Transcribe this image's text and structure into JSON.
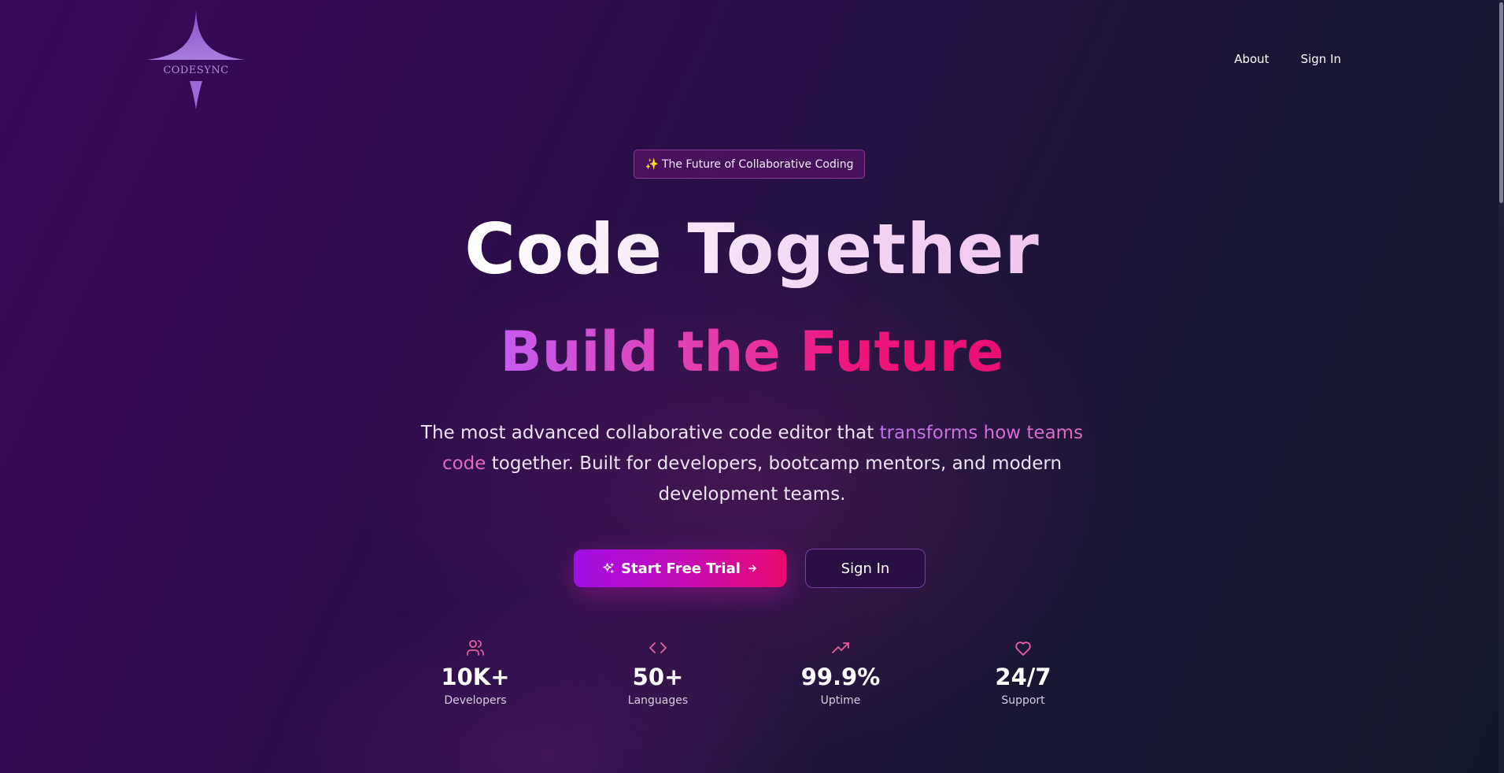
{
  "logo": {
    "text": "CODESYNC",
    "icon": "four-point-star-icon",
    "color": "#9a6ad6"
  },
  "nav": {
    "items": [
      {
        "label": "About"
      },
      {
        "label": "Sign In"
      }
    ]
  },
  "hero": {
    "badge": {
      "icon": "sparkles-icon",
      "emoji": "✨",
      "label": "The Future of Collaborative Coding"
    },
    "title": "Code Together",
    "subtitle": "Build the Future",
    "description_before": "The most advanced collaborative code editor that ",
    "description_highlight": "transforms how teams code",
    "description_after": " together. Built for developers, bootcamp mentors, and modern development teams.",
    "primary_button": {
      "label": "Start Free Trial",
      "icon_left": "sparkles-icon",
      "icon_right": "arrow-right-icon"
    },
    "secondary_button": {
      "label": "Sign In"
    }
  },
  "stats": [
    {
      "icon": "users-icon",
      "value": "10K+",
      "label": "Developers"
    },
    {
      "icon": "code-icon",
      "value": "50+",
      "label": "Languages"
    },
    {
      "icon": "trending-up-icon",
      "value": "99.9%",
      "label": "Uptime"
    },
    {
      "icon": "heart-icon",
      "value": "24/7",
      "label": "Support"
    }
  ],
  "colors": {
    "accent_pink": "#ea0a70",
    "accent_purple": "#a10ee6",
    "icon_pink": "#ec5fa0",
    "background_start": "#3a0858",
    "background_end": "#101828"
  }
}
